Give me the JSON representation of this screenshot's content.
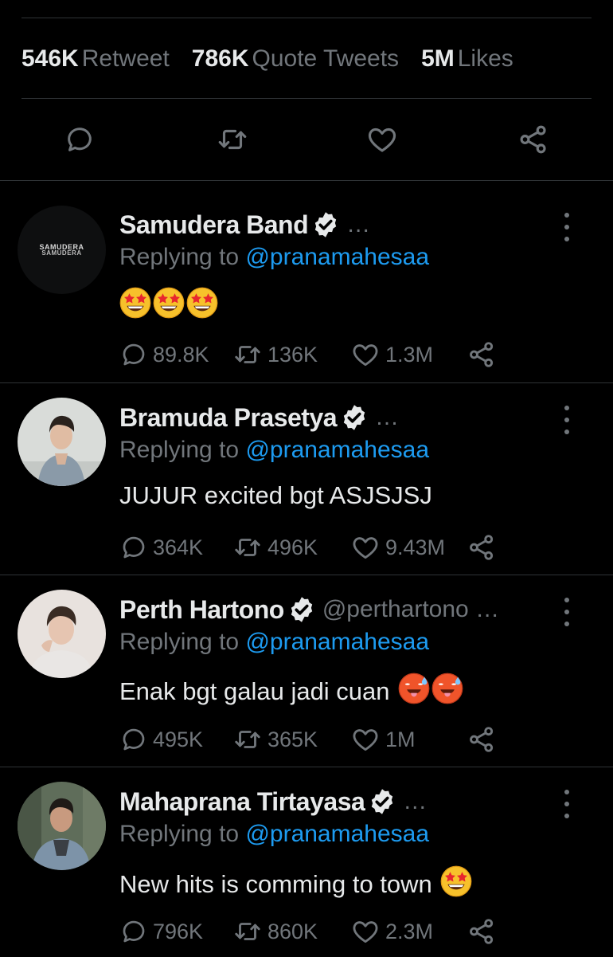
{
  "stats": [
    {
      "value": "546K",
      "label": "Retweet"
    },
    {
      "value": "786K",
      "label": "Quote Tweets"
    },
    {
      "value": "5M",
      "label": "Likes"
    }
  ],
  "actions": [
    "reply-icon",
    "retweet-icon",
    "like-icon",
    "share-icon"
  ],
  "reply_prefix": "Replying to",
  "tweets": [
    {
      "name": "Samudera Band",
      "handle": "…",
      "avatar_text": [
        "SAMUDERA",
        "SAMUDERA"
      ],
      "reply_to": "@pranamahesaa",
      "text": "",
      "emoji": [
        "star-struck",
        "star-struck",
        "star-struck"
      ],
      "replies": "89.8K",
      "retweets": "136K",
      "likes": "1.3M"
    },
    {
      "name": "Bramuda Prasetya",
      "handle": "…",
      "reply_to": "@pranamahesaa",
      "text": "JUJUR excited bgt ASJSJSJ",
      "emoji": [],
      "replies": "364K",
      "retweets": "496K",
      "likes": "9.43M"
    },
    {
      "name": "Perth Hartono",
      "handle": "@perthartono …",
      "reply_to": "@pranamahesaa",
      "text": "Enak bgt galau jadi cuan",
      "emoji": [
        "hot-face",
        "hot-face"
      ],
      "replies": "495K",
      "retweets": "365K",
      "likes": "1M"
    },
    {
      "name": "Mahaprana Tirtayasa",
      "handle": "…",
      "reply_to": "@pranamahesaa",
      "text": "New hits is comming to town",
      "emoji": [
        "star-struck"
      ],
      "replies": "796K",
      "retweets": "860K",
      "likes": "2.3M"
    }
  ],
  "colors": {
    "background": "#000000",
    "text": "#e7e9ea",
    "muted": "#71767b",
    "link": "#1d9bf0",
    "divider": "#2f3336"
  }
}
